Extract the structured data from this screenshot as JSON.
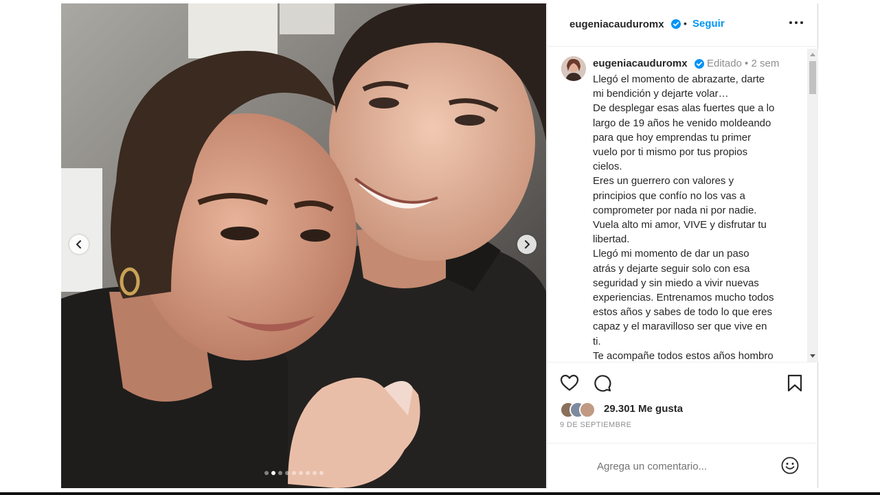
{
  "header": {
    "username": "eugeniacauduromx",
    "separator": "•",
    "follow_label": "Seguir",
    "more_icon": "more-horizontal-icon"
  },
  "post": {
    "author": "eugeniacauduromx",
    "edited_label": "Editado",
    "meta_separator": "•",
    "age": "2 sem",
    "caption_lines": [
      "Llegó el momento de abrazarte, darte",
      "mi bendición y dejarte volar…",
      "De desplegar esas alas fuertes que a lo",
      "largo de 19 años he venido moldeando",
      "para que hoy emprendas tu primer",
      "vuelo por ti mismo por tus propios",
      "cielos.",
      "Eres un guerrero con valores y",
      "principios que confío no los vas a",
      "comprometer por nada ni por nadie.",
      "Vuela alto mi amor, VIVE y disfrutar tu",
      "libertad.",
      "Llegó mi momento de dar un paso",
      "atrás y dejarte seguir solo con esa",
      "seguridad y sin miedo a vivir nuevas",
      "experiencias. Entrenamos mucho todos",
      "estos años y sabes de todo lo que eres",
      "capaz y el maravilloso ser que vive en",
      "ti.",
      "Te acompañe todos estos años hombro"
    ]
  },
  "actions": {
    "likes_text": "29.301 Me gusta",
    "date_text": "9 DE SEPTIEMBRE"
  },
  "comment": {
    "placeholder": "Agrega un comentario..."
  },
  "carousel": {
    "total_slides": 9,
    "active_index": 1
  },
  "colors": {
    "accent": "#0095f6",
    "verified": "#0095f6",
    "text": "#262626",
    "muted": "#8e8e8e"
  }
}
